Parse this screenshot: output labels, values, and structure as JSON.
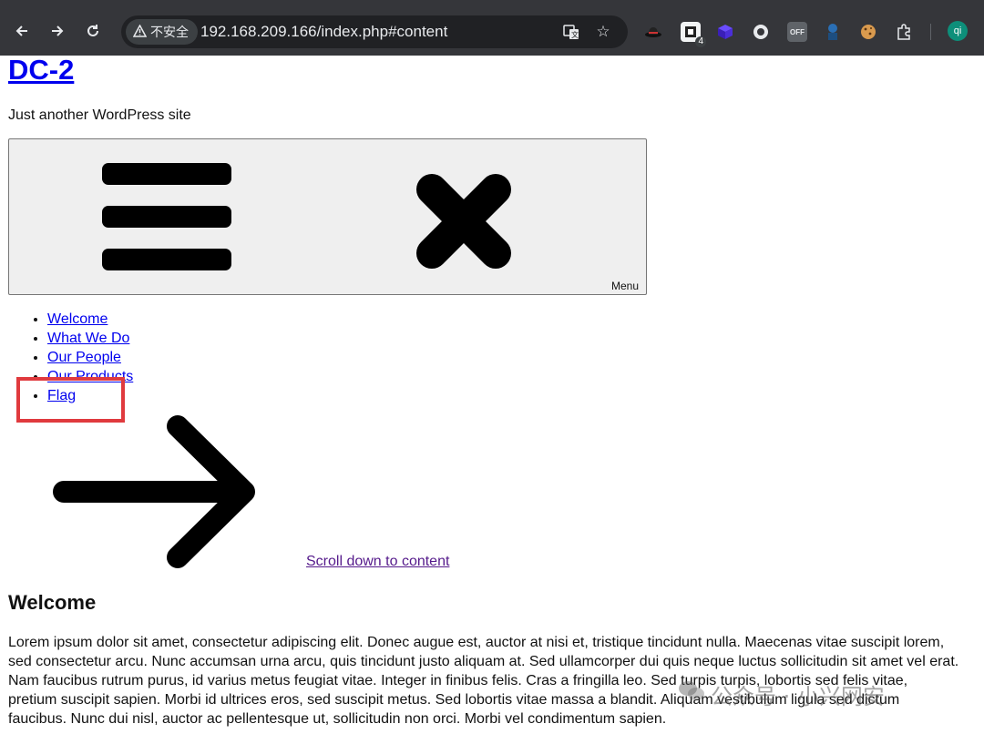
{
  "browser": {
    "security_label": "不安全",
    "url": "192.168.209.166/index.php#content",
    "extensions": [
      {
        "name": "hat-extension-icon"
      },
      {
        "name": "puzzle-badge-extension-icon",
        "badge": "4"
      },
      {
        "name": "cube-extension-icon"
      },
      {
        "name": "circle-extension-icon"
      },
      {
        "name": "off-extension-icon",
        "label": "OFF"
      },
      {
        "name": "robot-extension-icon"
      },
      {
        "name": "cookie-extension-icon"
      }
    ],
    "profile_initials": "qi"
  },
  "site": {
    "title": "DC-2",
    "tagline": "Just another WordPress site",
    "menu_toggle_label": "Menu"
  },
  "nav": {
    "items": [
      {
        "label": "Welcome"
      },
      {
        "label": "What We Do"
      },
      {
        "label": "Our People"
      },
      {
        "label": "Our Products"
      },
      {
        "label": "Flag"
      }
    ]
  },
  "scroll_link": "Scroll down to content",
  "content": {
    "heading": "Welcome",
    "lines": [
      "Lorem ipsum dolor sit amet, consectetur adipiscing elit. Donec augue est, auctor at nisi et, tristique tincidunt nulla. Maecenas vitae suscipit lorem,",
      "sed consectetur arcu. Nunc accumsan urna arcu, quis tincidunt justo aliquam at. Sed ullamcorper dui quis neque luctus sollicitudin sit amet vel erat.",
      "Nam faucibus rutrum purus, id varius metus feugiat vitae. Integer in finibus felis. Cras a fringilla leo. Sed turpis turpis, lobortis sed felis vitae,",
      "pretium suscipit sapien. Morbi id ultrices eros, sed suscipit metus. Sed lobortis vitae massa a blandit. Aliquam vestibulum ligula sed dictum",
      "faucibus. Nunc dui nisl, auctor ac pellentesque ut, sollicitudin non orci. Morbi vel condimentum sapien."
    ]
  },
  "watermark": "公众号 · 小兴网安",
  "colors": {
    "link": "#0000ee",
    "visited_link": "#551a8b",
    "highlight": "#e03a3e",
    "chrome_bg": "#35363a"
  }
}
